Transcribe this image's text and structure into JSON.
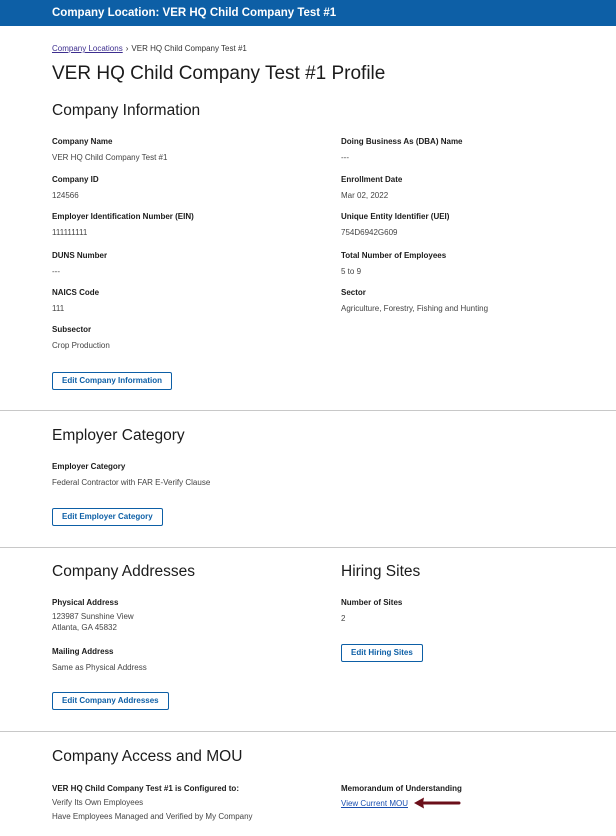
{
  "topbar": {
    "title": "Company Location: VER HQ Child Company Test #1"
  },
  "breadcrumb": {
    "parent": "Company Locations",
    "separator": "›",
    "current": "VER HQ Child Company Test #1"
  },
  "page": {
    "title": "VER HQ Child Company Test #1 Profile"
  },
  "company_info": {
    "title": "Company Information",
    "fields": {
      "company_name": {
        "label": "Company Name",
        "value": "VER HQ Child Company Test #1"
      },
      "dba_name": {
        "label": "Doing Business As (DBA) Name",
        "value": "---"
      },
      "company_id": {
        "label": "Company ID",
        "value": "124566"
      },
      "enrollment_date": {
        "label": "Enrollment Date",
        "value": "Mar 02, 2022"
      },
      "ein": {
        "label": "Employer Identification Number (EIN)",
        "value": "111111111"
      },
      "uei": {
        "label": "Unique Entity Identifier (UEI)",
        "value": "754D6942G609"
      },
      "duns": {
        "label": "DUNS Number",
        "value": "---"
      },
      "total_employees": {
        "label": "Total Number of Employees",
        "value": "5 to 9"
      },
      "naics": {
        "label": "NAICS Code",
        "value": "111"
      },
      "sector": {
        "label": "Sector",
        "value": "Agriculture, Forestry, Fishing and Hunting"
      },
      "subsector": {
        "label": "Subsector",
        "value": "Crop Production"
      }
    },
    "edit_button": "Edit Company Information"
  },
  "employer_category": {
    "title": "Employer Category",
    "label": "Employer Category",
    "value": "Federal Contractor with FAR E-Verify Clause",
    "edit_button": "Edit Employer Category"
  },
  "addresses": {
    "title": "Company Addresses",
    "physical_label": "Physical Address",
    "physical_line1": "123987 Sunshine View",
    "physical_line2": "Atlanta, GA 45832",
    "mailing_label": "Mailing Address",
    "mailing_value": "Same as Physical Address",
    "edit_button": "Edit Company Addresses"
  },
  "hiring_sites": {
    "title": "Hiring Sites",
    "label": "Number of Sites",
    "value": "2",
    "edit_button": "Edit Hiring Sites"
  },
  "access_mou": {
    "title": "Company Access and MOU",
    "configured_label": "VER HQ Child Company Test #1 is Configured to:",
    "line1": "Verify Its Own Employees",
    "line2": "Have Employees Managed and Verified by My Company",
    "mou_label": "Memorandum of Understanding",
    "mou_link": "View Current MOU"
  },
  "colors": {
    "brand": "#0d5fa6",
    "annotation_arrow": "#6b0f1a",
    "link": "#1a4fb0"
  },
  "icons": {
    "annotation": "arrow-left-icon"
  }
}
